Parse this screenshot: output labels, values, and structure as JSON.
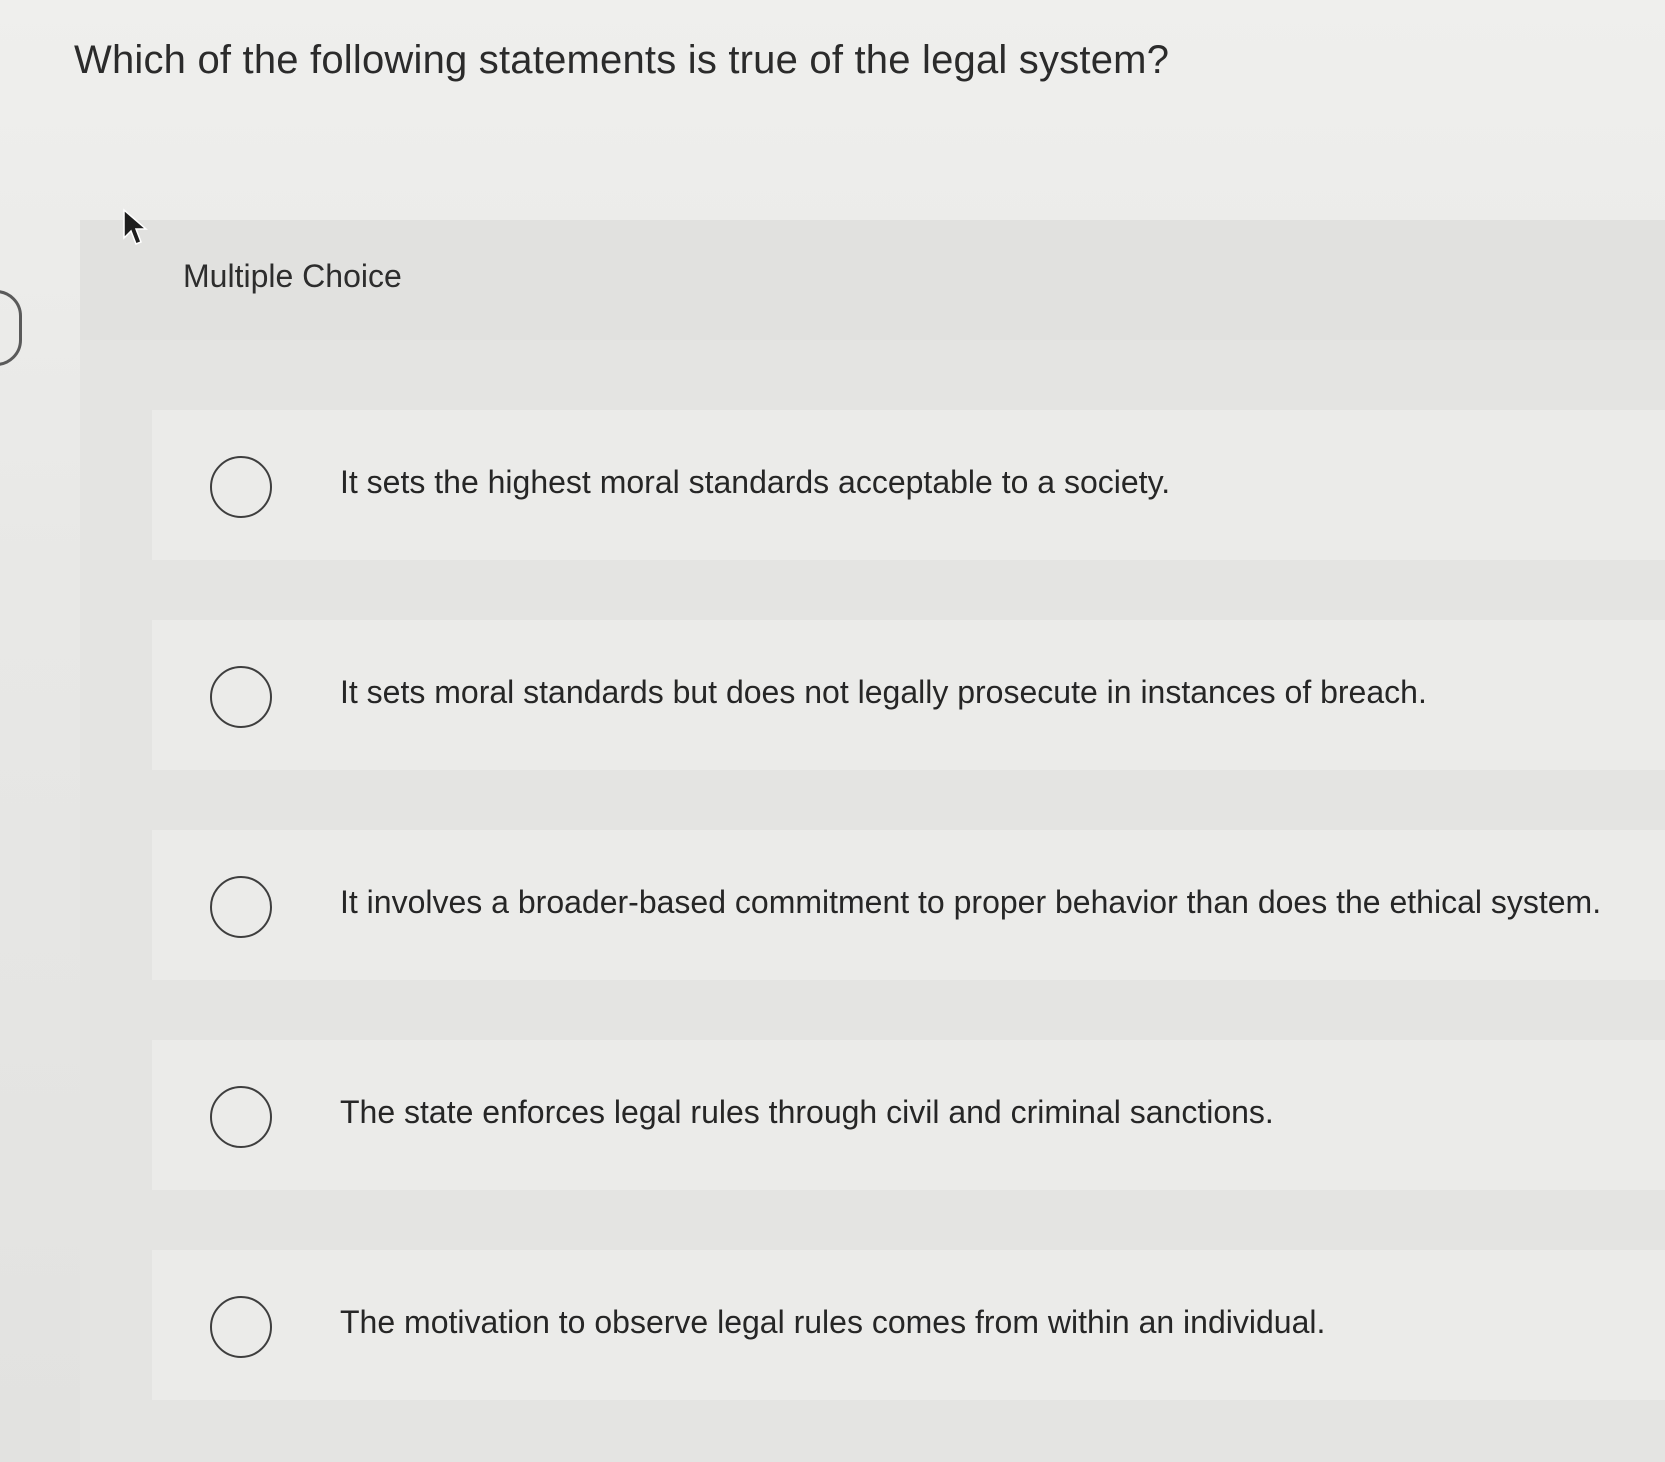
{
  "question": {
    "text": "Which of the following statements is true of the legal system?"
  },
  "section": {
    "label": "Multiple Choice"
  },
  "options": [
    {
      "text": "It sets the highest moral standards acceptable to a society.",
      "selected": false
    },
    {
      "text": "It sets moral standards but does not legally prosecute in instances of breach.",
      "selected": false
    },
    {
      "text": "It involves a broader-based commitment to proper behavior than does the ethical system.",
      "selected": false
    },
    {
      "text": "The state enforces legal rules through civil and criminal sanctions.",
      "selected": false
    },
    {
      "text": "The motivation to observe legal rules comes from within an individual.",
      "selected": false
    }
  ],
  "colors": {
    "background": "#e9e9e7",
    "text": "#2a2a2a",
    "radio_border": "#3e3e3e"
  },
  "icons": {
    "cursor": "mouse-pointer-icon",
    "radio": "radio-unchecked-icon"
  }
}
